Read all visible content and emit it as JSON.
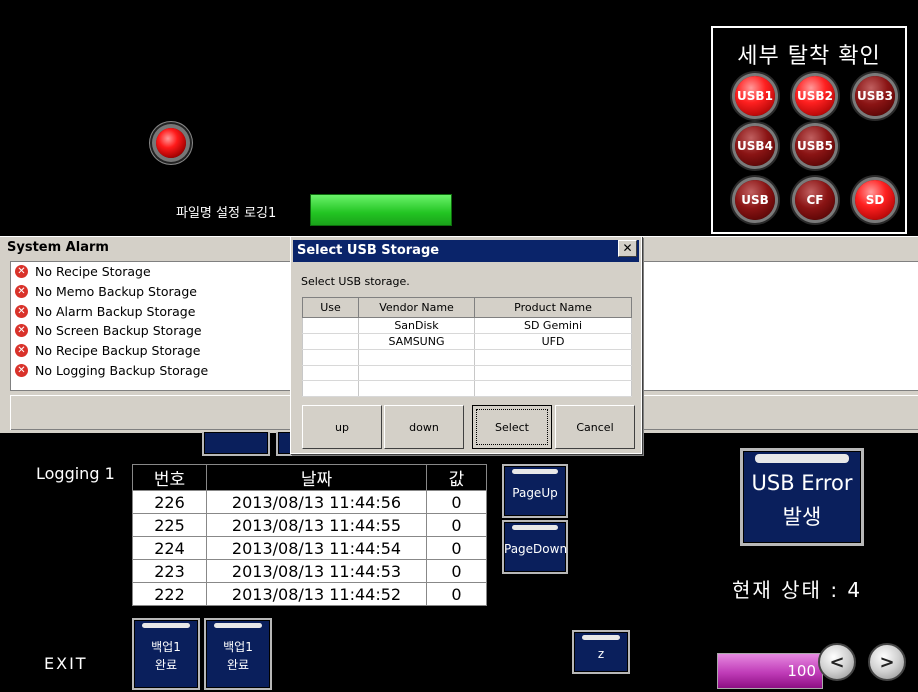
{
  "top": {
    "filename_label": "파일명 설정 로깅1"
  },
  "usb_panel": {
    "title": "세부 탈착 확인",
    "buttons": [
      "USB1",
      "USB2",
      "USB3",
      "USB4",
      "USB5",
      "USB",
      "CF",
      "SD"
    ]
  },
  "alarm_window": {
    "title": "System Alarm",
    "items": [
      "No Recipe Storage",
      "No Memo Backup Storage",
      "No Alarm Backup Storage",
      "No Screen Backup Storage",
      "No Recipe Backup Storage",
      "No Logging Backup Storage"
    ]
  },
  "dialog": {
    "title": "Select USB Storage",
    "close": "✕",
    "message": "Select USB storage.",
    "columns": [
      "Use",
      "Vendor Name",
      "Product Name"
    ],
    "rows": [
      [
        "",
        "SanDisk",
        "SD  Gemini"
      ],
      [
        "",
        "SAMSUNG",
        "UFD"
      ]
    ],
    "buttons": {
      "up": "up",
      "down": "down",
      "select": "Select",
      "cancel": "Cancel"
    }
  },
  "logging": {
    "label": "Logging 1",
    "columns": [
      "번호",
      "날짜",
      "값"
    ],
    "rows": [
      [
        "226",
        "2013/08/13  11:44:56",
        "0"
      ],
      [
        "225",
        "2013/08/13  11:44:55",
        "0"
      ],
      [
        "224",
        "2013/08/13  11:44:54",
        "0"
      ],
      [
        "223",
        "2013/08/13  11:44:53",
        "0"
      ],
      [
        "222",
        "2013/08/13  11:44:52",
        "0"
      ]
    ],
    "page_up": "PageUp",
    "page_down": "PageDown"
  },
  "backup_buttons": [
    {
      "line1": "백업1",
      "line2": "완료"
    },
    {
      "line1": "백업1",
      "line2": "완료"
    }
  ],
  "z_button": "z",
  "usb_error": {
    "line1": "USB Error",
    "line2": "발생"
  },
  "status": "현재 상태 : 4",
  "exit": "EXIT",
  "progress": {
    "value": "100",
    "level": 1.0
  },
  "nav": {
    "prev": "<",
    "next": ">"
  }
}
